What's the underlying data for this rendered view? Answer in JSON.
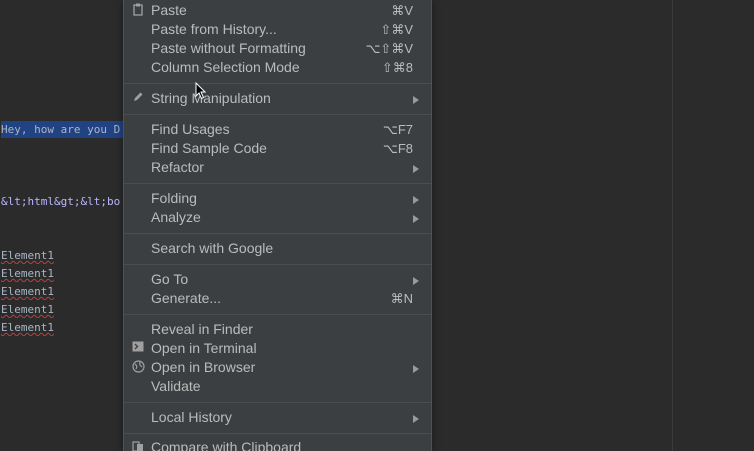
{
  "editor": {
    "lines": [
      {
        "text": "Hey, how are you D",
        "kind": "selected"
      },
      {
        "text": "&lt;html&gt;&lt;bo",
        "kind": "entity"
      },
      {
        "text": "Element1",
        "kind": "squiggle"
      },
      {
        "text": "Element1",
        "kind": "squiggle"
      },
      {
        "text": "Element1",
        "kind": "squiggle"
      },
      {
        "text": "Element1",
        "kind": "squiggle"
      },
      {
        "text": "Element1",
        "kind": "squiggle"
      }
    ]
  },
  "menu": {
    "items": [
      {
        "label": "Paste",
        "shortcut": "⌘V",
        "icon": "clipboard-icon"
      },
      {
        "label": "Paste from History...",
        "shortcut": "⇧⌘V"
      },
      {
        "label": "Paste without Formatting",
        "shortcut": "⌥⇧⌘V"
      },
      {
        "label": "Column Selection Mode",
        "shortcut": "⇧⌘8"
      },
      {
        "label": "String Manipulation",
        "submenu": true,
        "icon": "pencil-icon"
      },
      {
        "label": "Find Usages",
        "shortcut": "⌥F7"
      },
      {
        "label": "Find Sample Code",
        "shortcut": "⌥F8"
      },
      {
        "label": "Refactor",
        "submenu": true
      },
      {
        "label": "Folding",
        "submenu": true
      },
      {
        "label": "Analyze",
        "submenu": true
      },
      {
        "label": "Search with Google"
      },
      {
        "label": "Go To",
        "submenu": true
      },
      {
        "label": "Generate...",
        "shortcut": "⌘N"
      },
      {
        "label": "Reveal in Finder"
      },
      {
        "label": "Open in Terminal",
        "icon": "terminal-icon"
      },
      {
        "label": "Open in Browser",
        "submenu": true,
        "icon": "globe-icon"
      },
      {
        "label": "Validate"
      },
      {
        "label": "Local History",
        "submenu": true
      },
      {
        "label": "Compare with Clipboard",
        "icon": "compare-icon"
      }
    ]
  },
  "colors": {
    "editor_bg": "#2b2b2b",
    "menu_bg": "#3c3f41",
    "menu_text": "#bbbbbb",
    "selection": "#214283"
  }
}
